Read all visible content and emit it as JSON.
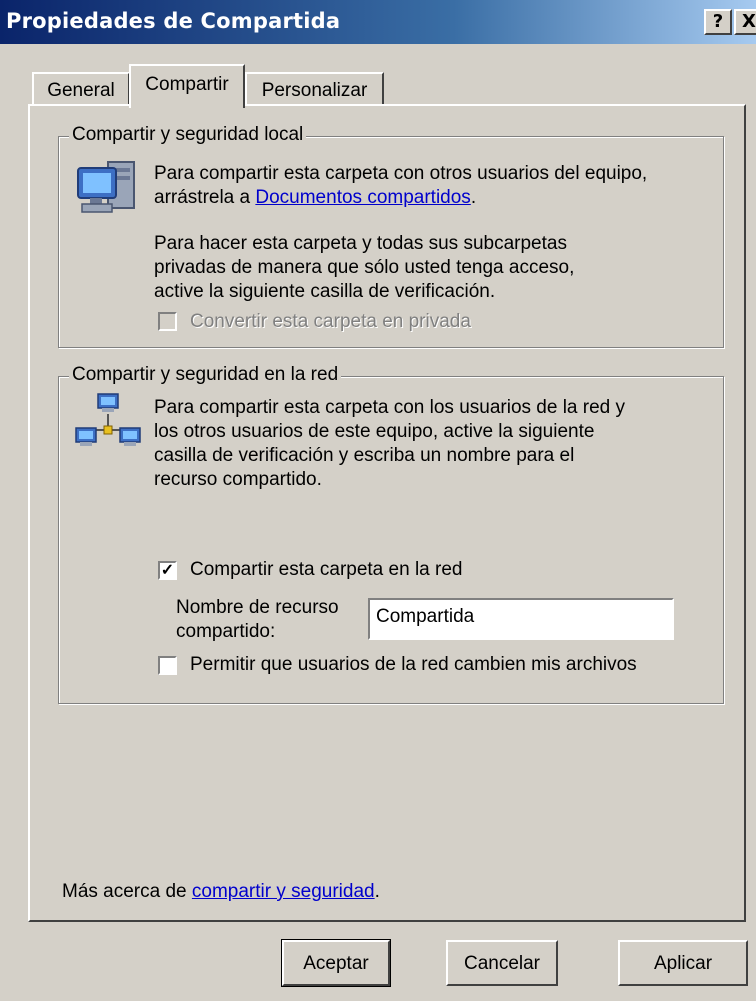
{
  "window": {
    "title": "Propiedades de Compartida",
    "help_glyph": "?",
    "close_glyph": "X"
  },
  "tabs": [
    {
      "label": "General"
    },
    {
      "label": "Compartir",
      "selected": true
    },
    {
      "label": "Personalizar"
    }
  ],
  "local_group": {
    "legend": "Compartir y seguridad local",
    "line1": "Para compartir esta carpeta con otros usuarios del equipo,",
    "line2_prefix": "arrástrela a ",
    "line2_link": "Documentos compartidos",
    "line2_suffix": ".",
    "para2": [
      "Para hacer esta carpeta y todas sus subcarpetas",
      "privadas de manera que sólo usted tenga acceso,",
      "active la siguiente casilla de verificación."
    ],
    "private_checkbox_label": "Convertir esta carpeta en privada",
    "private_checked": false,
    "private_enabled": false
  },
  "network_group": {
    "legend": "Compartir y seguridad en la red",
    "para": [
      "Para compartir esta carpeta con los usuarios de la red y",
      "los otros usuarios de este equipo, active la siguiente",
      "casilla de verificación y escriba un nombre para el",
      "recurso compartido."
    ],
    "share_checkbox_label": "Compartir esta carpeta en la red",
    "share_checked": true,
    "share_name_label_1": "Nombre de recurso",
    "share_name_label_2": "compartido:",
    "share_name_value": "Compartida",
    "allow_change_label": "Permitir que usuarios de la red cambien mis archivos",
    "allow_change_checked": false
  },
  "footer": {
    "more_prefix": "Más acerca de ",
    "more_link": "compartir y seguridad",
    "more_suffix": "."
  },
  "buttons": {
    "ok": "Aceptar",
    "cancel": "Cancelar",
    "apply": "Aplicar"
  }
}
